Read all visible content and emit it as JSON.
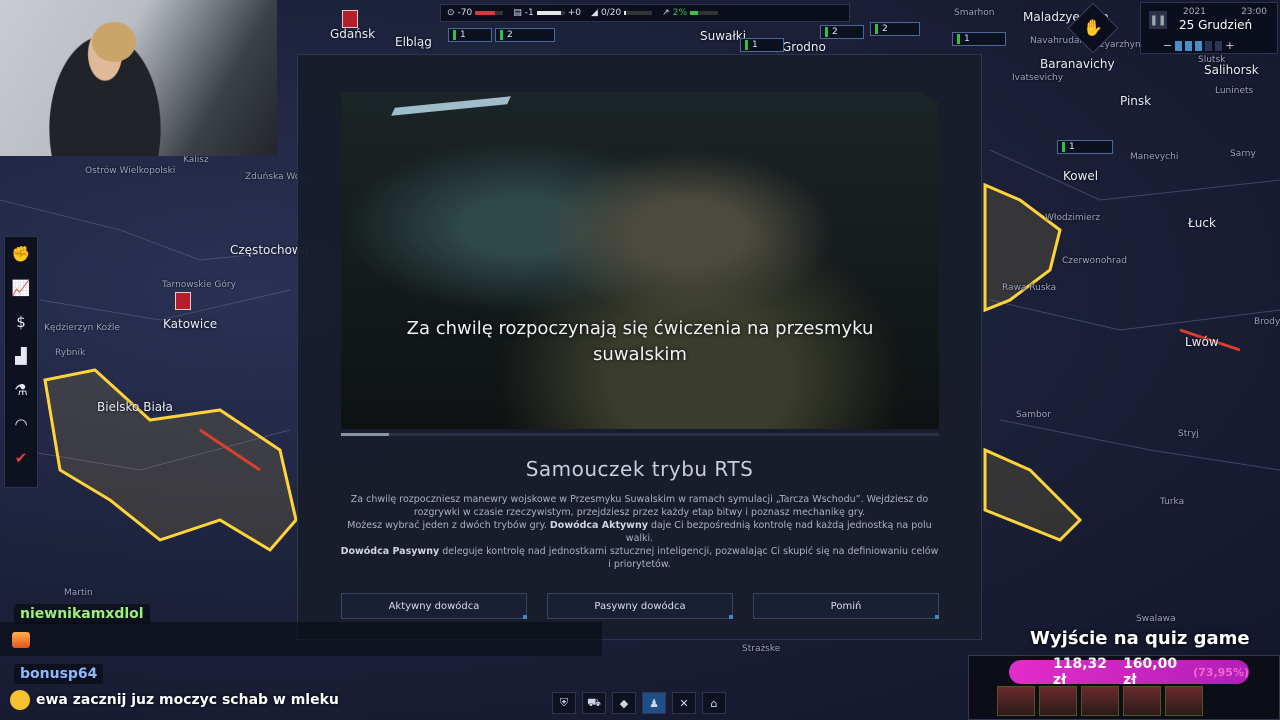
{
  "topbar": {
    "stability": "-70",
    "relations": "-1",
    "relations_delta": "+0",
    "units": "0/20",
    "growth": "2%"
  },
  "clock": {
    "year": "2021",
    "time": "23:00",
    "date": "25 Grudzień",
    "speed_minus": "−",
    "speed_plus": "+"
  },
  "map": {
    "cities": [
      "Gdańsk",
      "Elbląg",
      "Suwałki",
      "Grodno",
      "Maladzyechna",
      "Baranavichy",
      "Salihorsk",
      "Pinsk",
      "Kowel",
      "Łuck",
      "Lwów",
      "Częstochowa",
      "Katowice",
      "Bielsko Biała"
    ],
    "towns": [
      "Ostrów Wielkopolski",
      "Kalisz",
      "Zduńska Wola",
      "Tarnowskie Góry",
      "Kędzierzyn Koźle",
      "Rybnik",
      "Martin",
      "Navahrudak",
      "Ivatsevichy",
      "Luninets",
      "Manevychi",
      "Sarny",
      "Włodzimierz",
      "Czerwonohrad",
      "Rawa Ruska",
      "Brody",
      "Sambor",
      "Stryj",
      "Turka",
      "Swalawa",
      "Strażske",
      "Smarhon",
      "Dzyarzhynsk",
      "Slutsk"
    ]
  },
  "left_toolbar": {
    "icons": [
      "handshake-icon",
      "chart-icon",
      "money-icon",
      "industry-icon",
      "research-icon",
      "helmet-icon",
      "emblem-icon"
    ]
  },
  "tutorial": {
    "subtitle": "Za chwilę rozpoczynają się ćwiczenia na przesmyku suwalskim",
    "title": "Samouczek trybu RTS",
    "para1": "Za chwilę rozpoczniesz manewry wojskowe w Przesmyku Suwalskim w ramach symulacji „Tarcza Wschodu”. Wejdziesz do rozgrywki w czasie rzeczywistym, przejdziesz przez każdy etap bitwy i poznasz mechanikę gry.",
    "para2_start": "Możesz wybrać jeden z dwóch trybów gry.",
    "active_term": "Dowódca Aktywny",
    "para2_end": "daje Ci bezpośrednią kontrolę nad każdą jednostką na polu walki.",
    "passive_term": "Dowódca Pasywny",
    "para3_end": "deleguje kontrolę nad jednostkami sztucznej inteligencji, pozwalając Ci skupić się na definiowaniu celów i priorytetów.",
    "progress": 0.08,
    "buttons": {
      "active": "Aktywny dowódca",
      "passive": "Pasywny dowódca",
      "skip": "Pomiń"
    }
  },
  "chat": {
    "user1": "niewnikamxdlol",
    "user1_color": "#9ef07a",
    "user2": "bonusp64",
    "user2_color": "#8fb8ff",
    "message": "ewa zacznij juz moczyc schab w mleku"
  },
  "quiz": {
    "title": "Wyjście na quiz game",
    "amount1": "118,32 zł",
    "amount2": "160,00 zł",
    "percent": "(73,95%)"
  },
  "bottombar": {
    "icons": [
      "shield-icon",
      "truck-icon",
      "tank-icon",
      "infantry-icon",
      "cross-icon",
      "hq-icon"
    ]
  }
}
